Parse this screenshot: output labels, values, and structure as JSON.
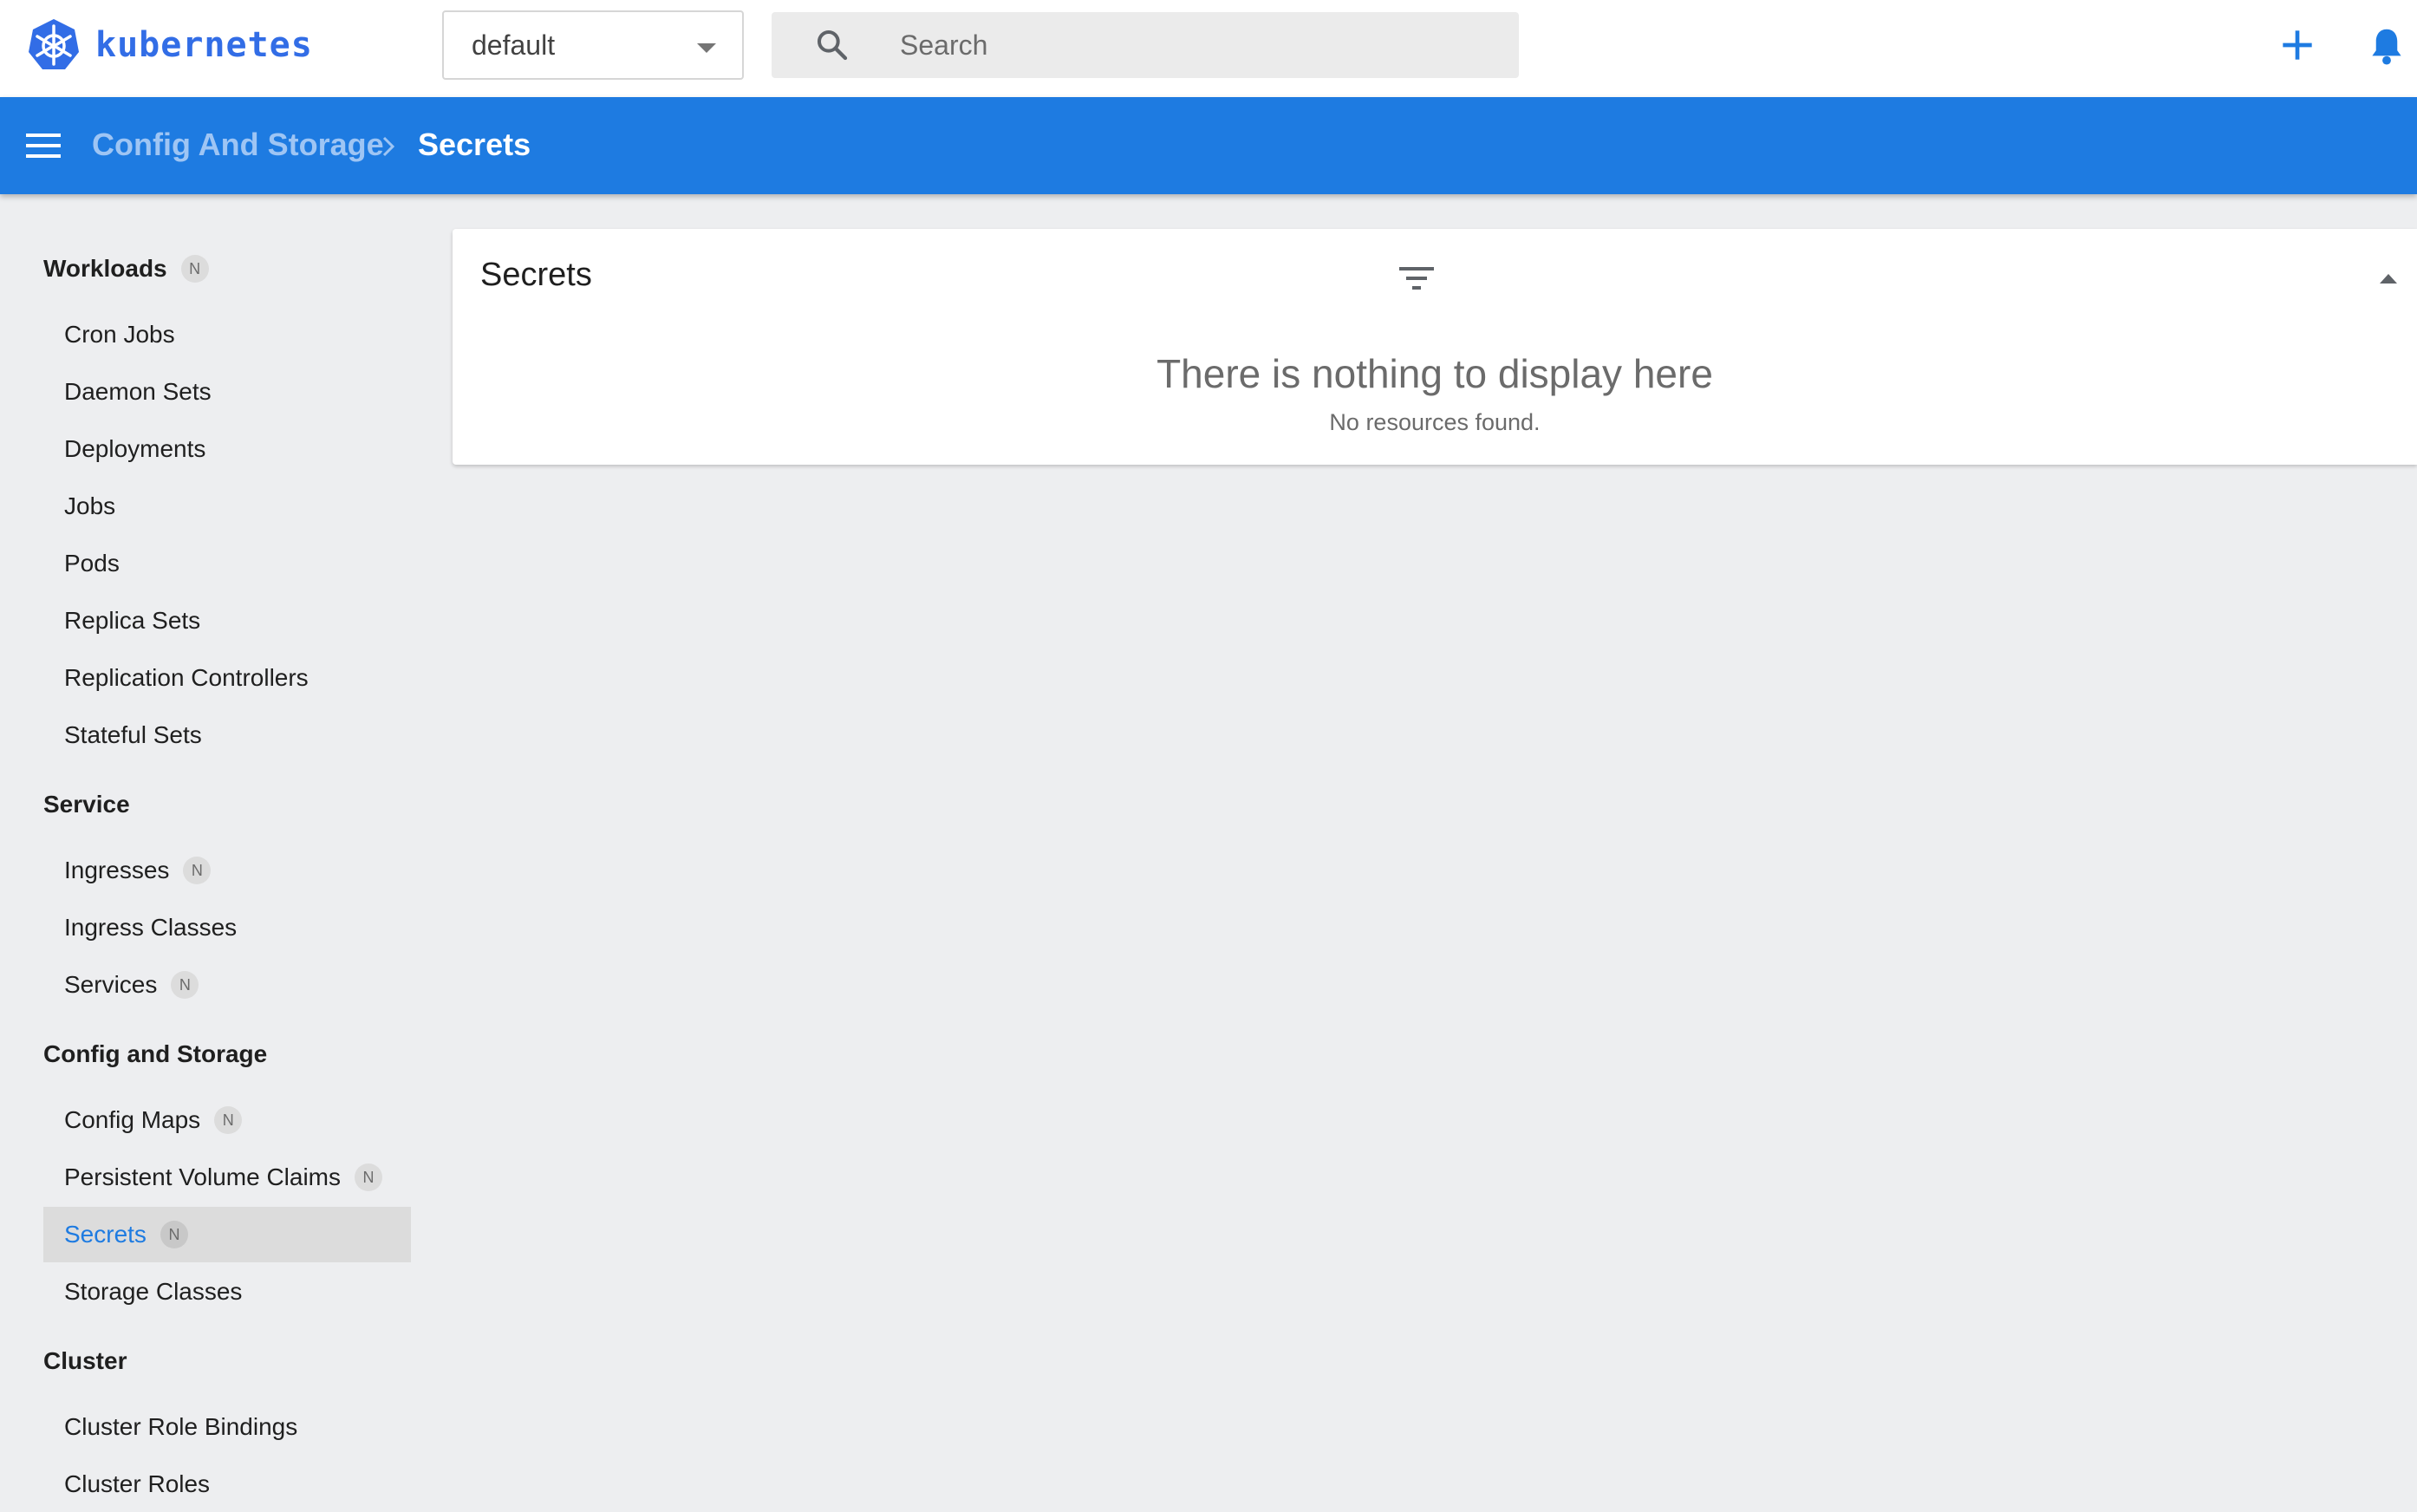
{
  "app": {
    "logo_text": "kubernetes",
    "brand_color": "#326de6",
    "header_color": "#1e7be1"
  },
  "namespace": {
    "selected": "default"
  },
  "search": {
    "placeholder": "Search",
    "value": ""
  },
  "toolbar": {
    "create_icon": "plus-icon",
    "notifications_icon": "bell-icon"
  },
  "breadcrumb": {
    "parent": "Config And Storage",
    "current": "Secrets"
  },
  "sidebar": {
    "groups": [
      {
        "label": "Workloads",
        "badge": "N",
        "items": [
          {
            "label": "Cron Jobs"
          },
          {
            "label": "Daemon Sets"
          },
          {
            "label": "Deployments"
          },
          {
            "label": "Jobs"
          },
          {
            "label": "Pods"
          },
          {
            "label": "Replica Sets"
          },
          {
            "label": "Replication Controllers"
          },
          {
            "label": "Stateful Sets"
          }
        ]
      },
      {
        "label": "Service",
        "items": [
          {
            "label": "Ingresses",
            "badge": "N"
          },
          {
            "label": "Ingress Classes"
          },
          {
            "label": "Services",
            "badge": "N"
          }
        ]
      },
      {
        "label": "Config and Storage",
        "items": [
          {
            "label": "Config Maps",
            "badge": "N"
          },
          {
            "label": "Persistent Volume Claims",
            "badge": "N"
          },
          {
            "label": "Secrets",
            "badge": "N",
            "active": true
          },
          {
            "label": "Storage Classes"
          }
        ]
      },
      {
        "label": "Cluster",
        "items": [
          {
            "label": "Cluster Role Bindings"
          },
          {
            "label": "Cluster Roles"
          }
        ]
      }
    ]
  },
  "card": {
    "title": "Secrets",
    "empty_title": "There is nothing to display here",
    "empty_subtitle": "No resources found."
  }
}
